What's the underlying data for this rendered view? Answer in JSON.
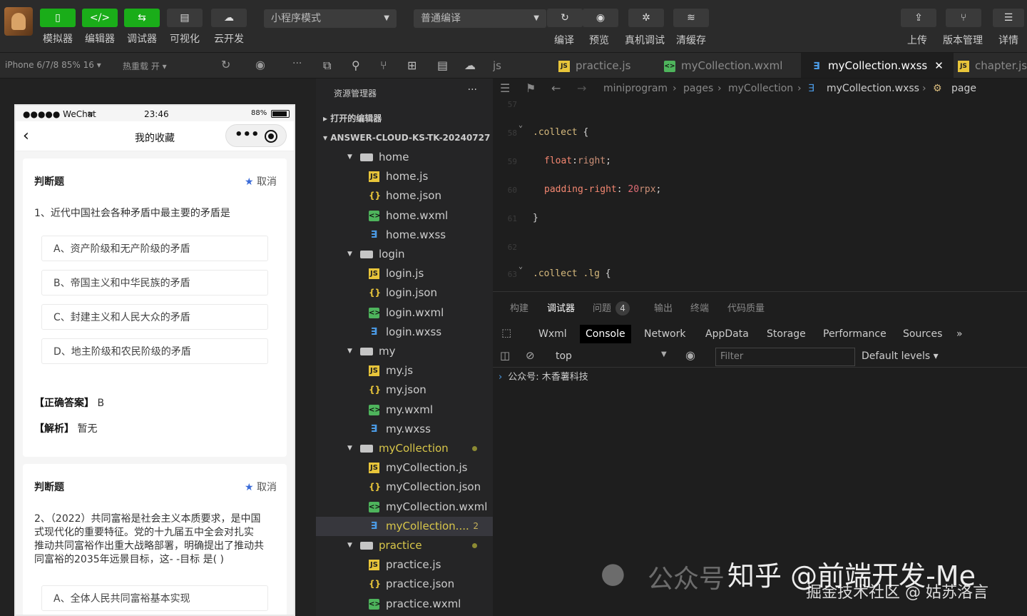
{
  "toolbar": {
    "buttons": [
      {
        "label": "模拟器",
        "icon": "▯"
      },
      {
        "label": "编辑器",
        "icon": "</>"
      },
      {
        "label": "调试器",
        "icon": "⇆"
      },
      {
        "label": "可视化",
        "icon": "▤"
      },
      {
        "label": "云开发",
        "icon": "☁"
      }
    ],
    "mode_select": "小程序模式",
    "compile_select": "普通编译",
    "actions": [
      {
        "label": "编译",
        "icon": "↻"
      },
      {
        "label": "预览",
        "icon": "◉"
      },
      {
        "label": "真机调试",
        "icon": "✲"
      },
      {
        "label": "清缓存",
        "icon": "≋"
      }
    ],
    "right": [
      {
        "label": "上传",
        "icon": "⇪"
      },
      {
        "label": "版本管理",
        "icon": "⑂"
      },
      {
        "label": "详情",
        "icon": "☰"
      }
    ]
  },
  "simulator": {
    "device": "iPhone 6/7/8 85% 16 ▾",
    "hotreload": "热重载 开 ▾",
    "status": {
      "carrier": "●●●●● WeChat",
      "time": "23:46",
      "battery": "88%"
    },
    "nav_title": "我的收藏",
    "cards": [
      {
        "type": "判断题",
        "cancel": "取消",
        "question": "1、近代中国社会各种矛盾中最主要的矛盾是",
        "options": [
          "A、资产阶级和无产阶级的矛盾",
          "B、帝国主义和中华民族的矛盾",
          "C、封建主义和人民大众的矛盾",
          "D、地主阶级和农民阶级的矛盾"
        ],
        "answer_label": "【正确答案】",
        "answer": "B",
        "analysis_label": "【解析】",
        "analysis": "暂无"
      },
      {
        "type": "判断题",
        "cancel": "取消",
        "question_lines": [
          "2、（2022）共同富裕是社会主义本质要求，是中国",
          "式现代化的重要特征。党的十九届五中全会对扎实",
          "推动共同富裕作出重大战略部署，明确提出了推动共",
          "同富裕的2035年远景目标，这- -目标 是( )"
        ],
        "options": [
          "A、全体人民共同富裕基本实现"
        ]
      }
    ]
  },
  "explorer": {
    "title": "资源管理器",
    "more": "···",
    "open_editors": "打开的编辑器",
    "project": "ANSWER-CLOUD-KS-TK-20240727",
    "tree": [
      {
        "name": "home",
        "kind": "folder"
      },
      {
        "name": "home.js",
        "kind": "js"
      },
      {
        "name": "home.json",
        "kind": "json"
      },
      {
        "name": "home.wxml",
        "kind": "wxml"
      },
      {
        "name": "home.wxss",
        "kind": "wxss"
      },
      {
        "name": "login",
        "kind": "folder"
      },
      {
        "name": "login.js",
        "kind": "js"
      },
      {
        "name": "login.json",
        "kind": "json"
      },
      {
        "name": "login.wxml",
        "kind": "wxml"
      },
      {
        "name": "login.wxss",
        "kind": "wxss"
      },
      {
        "name": "my",
        "kind": "folder"
      },
      {
        "name": "my.js",
        "kind": "js"
      },
      {
        "name": "my.json",
        "kind": "json"
      },
      {
        "name": "my.wxml",
        "kind": "wxml"
      },
      {
        "name": "my.wxss",
        "kind": "wxss"
      },
      {
        "name": "myCollection",
        "kind": "folder"
      },
      {
        "name": "myCollection.js",
        "kind": "js"
      },
      {
        "name": "myCollection.json",
        "kind": "json"
      },
      {
        "name": "myCollection.wxml",
        "kind": "wxml"
      },
      {
        "name": "myCollection....",
        "kind": "wxss",
        "badge": "2"
      },
      {
        "name": "practice",
        "kind": "folder"
      },
      {
        "name": "practice.js",
        "kind": "js"
      },
      {
        "name": "practice.json",
        "kind": "json"
      },
      {
        "name": "practice.wxml",
        "kind": "wxml"
      }
    ]
  },
  "tabs": [
    {
      "label": "js"
    },
    {
      "label": "practice.js"
    },
    {
      "label": "myCollection.wxml"
    },
    {
      "label": "myCollection.wxss",
      "close": "✕"
    },
    {
      "label": "chapter.js"
    }
  ],
  "breadcrumb": [
    "miniprogram",
    "pages",
    "myCollection",
    "myCollection.wxss",
    "page"
  ],
  "code": {
    "line_numbers": [
      "57",
      "58",
      "59",
      "60",
      "61",
      "62",
      "63"
    ],
    "l1_sel": ".collect",
    "l1_brace": " {",
    "l2_prop": "float",
    "l2_val": "right",
    "l3_prop": "padding-right",
    "l3_num": "20",
    "l3_unit": "rpx",
    "l4": "}",
    "l5_sel": ".collect .lg",
    "l5_brace": " {"
  },
  "debugger": {
    "tabs": [
      "构建",
      "调试器",
      "问题",
      "输出",
      "终端",
      "代码质量"
    ],
    "problem_count": "4",
    "panels": [
      "Wxml",
      "Console",
      "Network",
      "AppData",
      "Storage",
      "Performance",
      "Sources"
    ],
    "more": "»",
    "context": "top",
    "filter_placeholder": "Filter",
    "levels": "Default levels ▾",
    "log": "公众号: 木香薯科技"
  },
  "watermark": {
    "line1": "公众号",
    "line2": "知乎 @前端开发-Me",
    "line3": "掘金技术社区 @ 姑苏洛言"
  },
  "colors": {
    "accent_green": "#1aad19",
    "star_blue": "#3a6bd8"
  }
}
